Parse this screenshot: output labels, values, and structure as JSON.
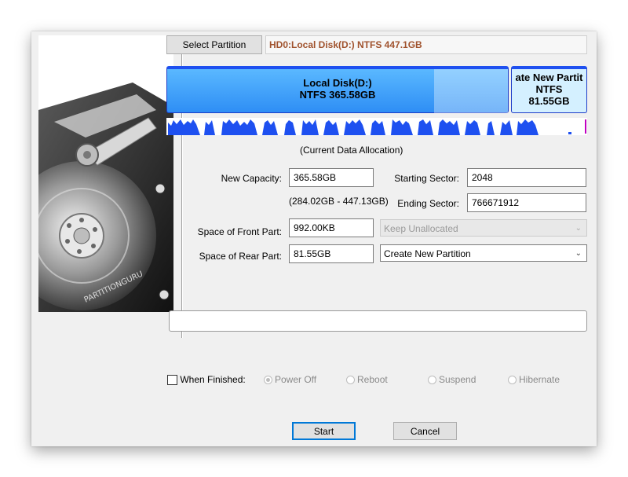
{
  "select_partition": {
    "button_label": "Select Partition",
    "current": "HD0:Local Disk(D:) NTFS 447.1GB"
  },
  "disk_map": {
    "primary": {
      "name": "Local Disk(D:)",
      "detail": "NTFS 365.58GB"
    },
    "new_partition": {
      "name": "ate New Partit",
      "fs": "NTFS",
      "size": "81.55GB"
    }
  },
  "allocation_caption": "(Current Data Allocation)",
  "form": {
    "new_capacity": {
      "label": "New Capacity:",
      "value": "365.58GB"
    },
    "range": "(284.02GB - 447.13GB)",
    "starting_sector": {
      "label": "Starting Sector:",
      "value": "2048"
    },
    "ending_sector": {
      "label": "Ending Sector:",
      "value": "766671912"
    },
    "front_space": {
      "label": "Space of Front Part:",
      "value": "992.00KB",
      "option": "Keep Unallocated"
    },
    "rear_space": {
      "label": "Space of Rear Part:",
      "value": "81.55GB",
      "option": "Create New Partition"
    }
  },
  "progress_text": "",
  "when_finished": {
    "label": "When Finished:",
    "options": [
      "Power Off",
      "Reboot",
      "Suspend",
      "Hibernate"
    ],
    "selected": "Power Off"
  },
  "buttons": {
    "start": "Start",
    "cancel": "Cancel"
  },
  "colors": {
    "accent": "#0078d7",
    "bar_blue": "#1e50f0",
    "title_text": "#a0522d",
    "bar_fill": "#3ba2ff",
    "new_part_fill": "#d4f0ff"
  }
}
